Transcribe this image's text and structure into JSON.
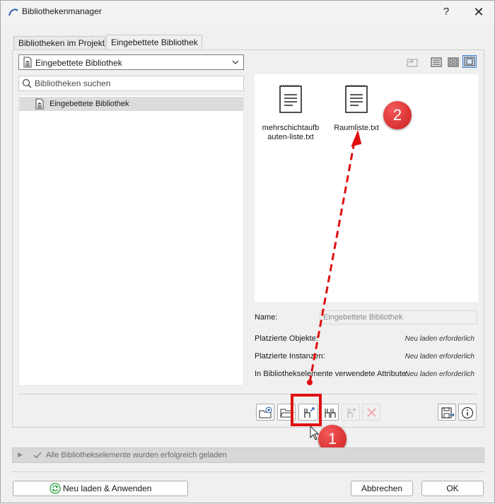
{
  "window": {
    "title": "Bibliothekenmanager",
    "help_label": "?",
    "close_label": "✕"
  },
  "tabs": [
    {
      "label": "Bibliotheken im Projekt",
      "active": false
    },
    {
      "label": "Eingebettete Bibliothek",
      "active": true
    }
  ],
  "library_dropdown": {
    "value": "Eingebettete Bibliothek"
  },
  "search": {
    "placeholder": "Bibliotheken suchen"
  },
  "tree": {
    "items": [
      {
        "label": "Eingebettete Bibliothek",
        "selected": true
      }
    ]
  },
  "files": [
    {
      "line1": "mehrschichtaufb",
      "line2": "auten-liste.txt"
    },
    {
      "line1": "Raumliste.txt",
      "line2": ""
    }
  ],
  "info": {
    "name_label": "Name:",
    "name_value": "Eingebettete Bibliothek",
    "rows": [
      {
        "label": "Platzierte Objekte:",
        "value": "Neu laden erforderlich"
      },
      {
        "label": "Platzierte Instanzen:",
        "value": "Neu laden erforderlich"
      },
      {
        "label": "In Bibliothekselemente verwendete Attribute:",
        "value": "Neu laden erforderlich"
      }
    ]
  },
  "status": {
    "message": "Alle Bibliothekselemente wurden erfolgreich geladen"
  },
  "buttons": {
    "reload_apply": "Neu laden & Anwenden",
    "cancel": "Abbrechen",
    "ok": "OK"
  },
  "annotations": {
    "badge1": "1",
    "badge2": "2"
  },
  "colors": {
    "highlight": "#e01010",
    "accent": "#3c7fd0",
    "reload_green": "#2ea043"
  }
}
